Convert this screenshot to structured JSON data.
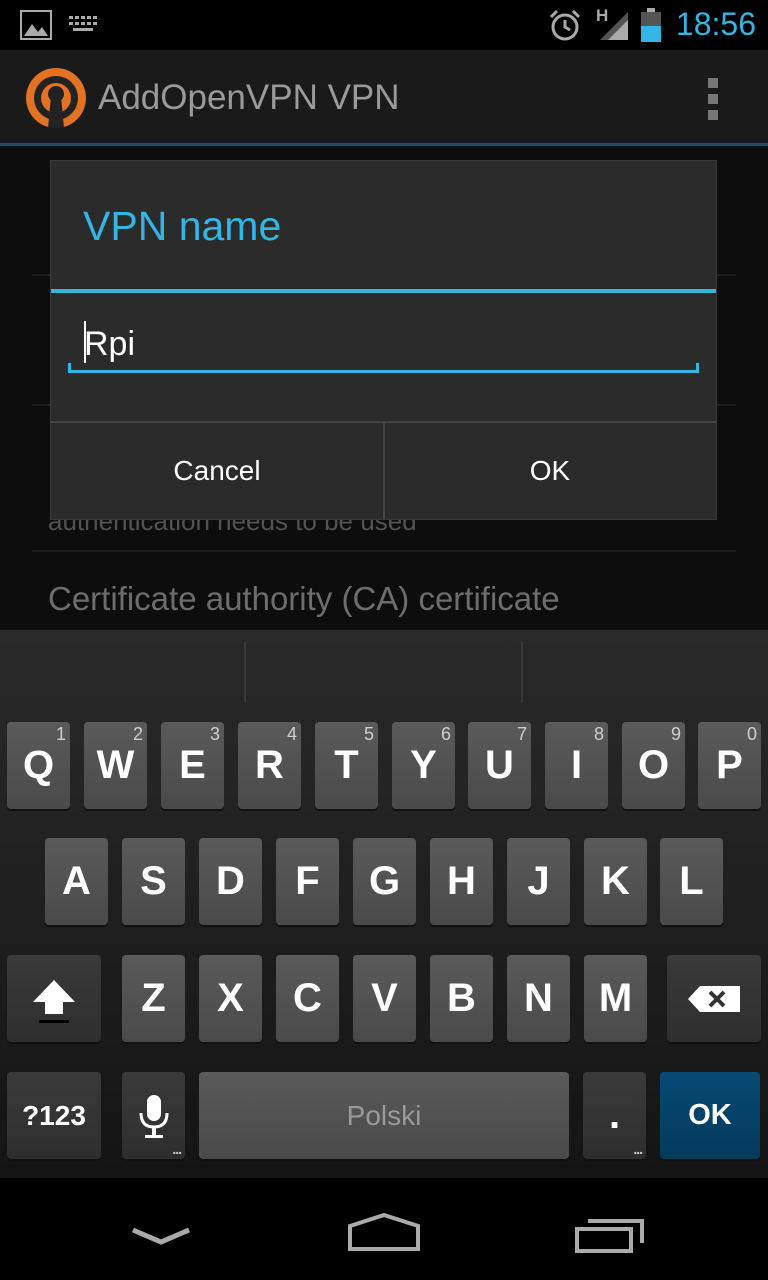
{
  "status_bar": {
    "time": "18:56",
    "network_label": "H",
    "icons": [
      "gallery-icon",
      "keyboard-icon",
      "alarm-icon",
      "signal-icon",
      "battery-icon"
    ]
  },
  "action_bar": {
    "title": "AddOpenVPN VPN",
    "logo": "openvpn-logo",
    "menu": "overflow-menu-icon"
  },
  "background_list": {
    "item_small_text": "authentication needs to be used",
    "item_big_text": "Certificate authority (CA) certificate"
  },
  "dialog": {
    "title": "VPN name",
    "input_value": "Rpi",
    "cancel_label": "Cancel",
    "ok_label": "OK"
  },
  "keyboard": {
    "row1": [
      {
        "label": "Q",
        "hint": "1"
      },
      {
        "label": "W",
        "hint": "2"
      },
      {
        "label": "E",
        "hint": "3"
      },
      {
        "label": "R",
        "hint": "4"
      },
      {
        "label": "T",
        "hint": "5"
      },
      {
        "label": "Y",
        "hint": "6"
      },
      {
        "label": "U",
        "hint": "7"
      },
      {
        "label": "I",
        "hint": "8"
      },
      {
        "label": "O",
        "hint": "9"
      },
      {
        "label": "P",
        "hint": "0"
      }
    ],
    "row2": [
      "A",
      "S",
      "D",
      "F",
      "G",
      "H",
      "J",
      "K",
      "L"
    ],
    "row3": [
      "Z",
      "X",
      "C",
      "V",
      "B",
      "N",
      "M"
    ],
    "symbols_label": "?123",
    "space_label": "Polski",
    "period_label": ".",
    "ok_label": "OK",
    "accent_color": "#33b5e5"
  },
  "nav_bar": {
    "icons": [
      "back-icon",
      "home-icon",
      "recents-icon"
    ]
  }
}
